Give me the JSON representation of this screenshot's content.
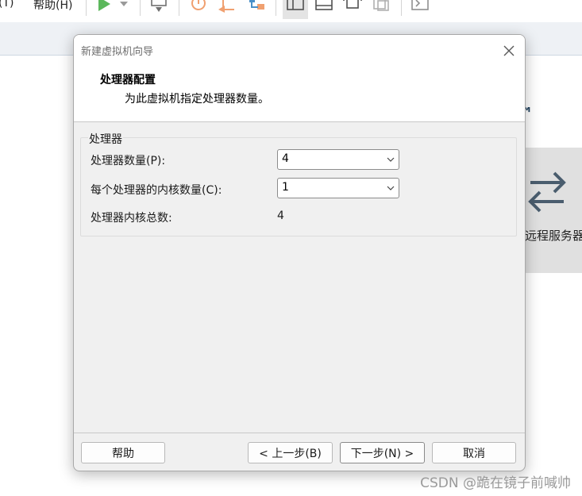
{
  "app": {
    "menu": [
      "(T)",
      "帮助(H)"
    ],
    "trademark": "™",
    "remote_card_label": "远程服务器",
    "watermark": "CSDN @跪在镜子前喊帅"
  },
  "dialog": {
    "title": "新建虚拟机向导",
    "heading": "处理器配置",
    "description": "为此虚拟机指定处理器数量。",
    "group_title": "处理器",
    "fields": {
      "processor_count": {
        "label": "处理器数量(P):",
        "value": "4"
      },
      "cores_per_processor": {
        "label": "每个处理器的内核数量(C):",
        "value": "1"
      },
      "total_cores": {
        "label": "处理器内核总数:",
        "value": "4"
      }
    },
    "buttons": {
      "help": "帮助",
      "back": "< 上一步(B)",
      "next": "下一步(N) >",
      "cancel": "取消"
    }
  },
  "colors": {
    "accent_green": "#4caf50",
    "icon_orange": "#f0a070",
    "icon_blue": "#4a90c8",
    "dialog_bg": "#f0f0f0"
  }
}
